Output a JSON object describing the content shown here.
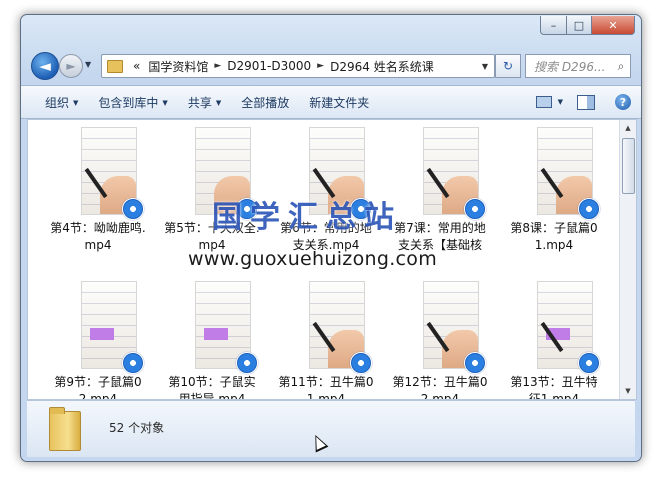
{
  "window": {
    "caption": {
      "minimize": "–",
      "maximize": "□",
      "close": "✕"
    }
  },
  "nav": {
    "back_glyph": "◄",
    "forward_glyph": "►",
    "history_glyph": "▼",
    "address": {
      "prefix": "«",
      "segments": [
        "国学资料馆",
        "D2901-D3000",
        "D2964 姓名系统课"
      ],
      "separator": "►",
      "dropdown": "▼"
    },
    "refresh_glyph": "↻",
    "search": {
      "placeholder": "搜索 D296...",
      "icon": "search-icon"
    }
  },
  "toolbar": {
    "organize": "组织",
    "include_in_library": "包含到库中",
    "share": "共享",
    "play_all": "全部播放",
    "new_folder": "新建文件夹",
    "arrow": "▼",
    "help": "?"
  },
  "files": [
    {
      "name": "第4节：呦呦鹿鸣.mp4"
    },
    {
      "name": "第5节：十天双全.mp4"
    },
    {
      "name": "第6节：常用的地支关系.mp4"
    },
    {
      "name": "第7课：常用的地支关系【基础核心】.mp4"
    },
    {
      "name": "第8课：子鼠篇01.mp4"
    },
    {
      "name": "第9节：子鼠篇02.mp4"
    },
    {
      "name": "第10节：子鼠实用指导.mp4"
    },
    {
      "name": "第11节：丑牛篇01.mp4"
    },
    {
      "name": "第12节：丑牛篇02.mp4"
    },
    {
      "name": "第13节：丑牛特征1.mp4"
    }
  ],
  "watermark": {
    "chinese": "国学汇总站",
    "url": "www.guoxuehuizong.com"
  },
  "status": {
    "count": "52 个对象"
  },
  "scroll": {
    "up": "▲",
    "down": "▼"
  }
}
